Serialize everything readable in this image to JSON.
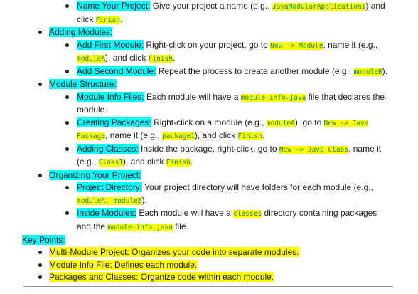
{
  "item1": {
    "label": "Name Your Project:",
    "t1": " Give your project a name (e.g., ",
    "c1": "JavaModularApplication1",
    "t2": ") and",
    "t3": "click ",
    "c2": "Finish",
    "t4": "."
  },
  "adding_modules": {
    "title": "Adding Modules:",
    "first": {
      "label": "Add First Module:",
      "t1": " Right-click on your project, go to ",
      "c1": "New -> Module",
      "t2": ", name it (e.g.,",
      "c2": "moduleA",
      "t3": "), and click ",
      "c3": "Finish",
      "t4": "."
    },
    "second": {
      "label": "Add Second Module:",
      "t1": " Repeat the process to create another module (e.g., ",
      "c1": "moduleB",
      "t2": ")."
    }
  },
  "module_structure": {
    "title": "Module Structure:",
    "info": {
      "label": "Module Info Files:",
      "t1": " Each module will have a ",
      "c1": "module-info.java",
      "t2": " file that declares the",
      "t3": "module."
    },
    "packages": {
      "label": "Creating Packages:",
      "t1": " Right-click on a module (e.g., ",
      "c1": "moduleA",
      "t2": "), go to ",
      "c2": "New -> Java",
      "c3": "Package",
      "t3": ", name it (e.g., ",
      "c4": "package1",
      "t4": "), and click ",
      "c5": "Finish",
      "t5": "."
    },
    "classes": {
      "label": "Adding Classes:",
      "t1": " Inside the package, right-click, go to ",
      "c1": "New -> Java Class",
      "t2": ", name it",
      "t3": "(e.g., ",
      "c2": "Class1",
      "t4": "), and click ",
      "c3": "Finish",
      "t5": "."
    }
  },
  "organizing": {
    "title": "Organizing Your Project:",
    "directory": {
      "label": "Project Directory:",
      "t1": " Your project directory will have folders for each module (e.g.,",
      "c1": "moduleA, moduleB",
      "t2": ")."
    },
    "inside": {
      "label": "Inside Modules:",
      "t1": " Each module will have a ",
      "c1": "classes",
      "t2": " directory containing packages",
      "t3": "and the ",
      "c2": "module-info.java",
      "t4": " file."
    }
  },
  "key_points": {
    "title": "Key Points:",
    "items": [
      {
        "label": "Multi-Module Project:",
        "text": " Organizes your code into separate modules."
      },
      {
        "label": "Module Info File:",
        "text": " Defines each module."
      },
      {
        "label": "Packages and Classes:",
        "text": " Organize code within each module."
      }
    ]
  },
  "colors": {
    "heading_highlight": "#00ffff",
    "text_highlight": "#ffff00",
    "code_text": "#1e8e3e"
  }
}
